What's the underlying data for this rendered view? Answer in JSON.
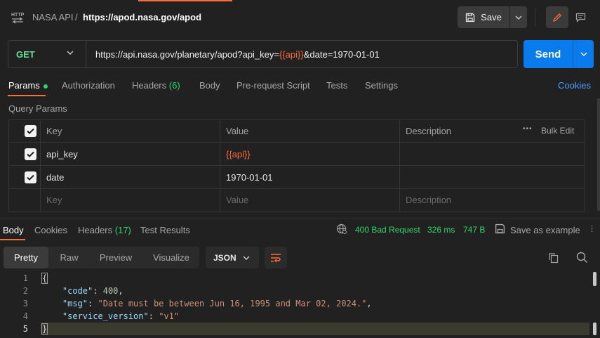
{
  "header": {
    "breadcrumb_parent": "NASA API",
    "breadcrumb_sep": "/",
    "title": "https://apod.nasa.gov/apod",
    "save_label": "Save"
  },
  "request": {
    "method": "GET",
    "url_prefix": "https://api.nasa.gov/planetary/apod?api_key=",
    "url_var": "{{api}}",
    "url_suffix": "&date=1970-01-01",
    "send_label": "Send"
  },
  "tabs": [
    {
      "label": "Params"
    },
    {
      "label": "Authorization"
    },
    {
      "label": "Headers",
      "count": "(6)"
    },
    {
      "label": "Body"
    },
    {
      "label": "Pre-request Script"
    },
    {
      "label": "Tests"
    },
    {
      "label": "Settings"
    }
  ],
  "cookies_label": "Cookies",
  "query_params": {
    "title": "Query Params",
    "columns": [
      "Key",
      "Value",
      "Description"
    ],
    "bulk_edit": "Bulk Edit",
    "more": "•••",
    "rows": [
      {
        "key": "api_key",
        "value": "{{api}}",
        "description": ""
      },
      {
        "key": "date",
        "value": "1970-01-01",
        "description": ""
      }
    ],
    "placeholder": {
      "key": "Key",
      "value": "Value",
      "description": "Description"
    }
  },
  "response": {
    "tabs": [
      {
        "label": "Body"
      },
      {
        "label": "Cookies"
      },
      {
        "label": "Headers",
        "count": "(17)"
      },
      {
        "label": "Test Results"
      }
    ],
    "status": "400 Bad Request",
    "time": "326 ms",
    "size": "747 B",
    "save_example": "Save as example",
    "views": [
      "Pretty",
      "Raw",
      "Preview",
      "Visualize"
    ],
    "format": "JSON",
    "code": {
      "line_numbers": [
        "1",
        "2",
        "3",
        "4",
        "5"
      ],
      "open_brace": "{",
      "close_brace": "}",
      "code_key": "\"code\"",
      "code_val": "400",
      "msg_key": "\"msg\"",
      "msg_val": "\"Date must be between Jun 16, 1995 and Mar 02, 2024.\"",
      "sv_key": "\"service_version\"",
      "sv_val": "\"v1\""
    }
  },
  "colors": {
    "accent": "#ff6c37",
    "send": "#097bed",
    "success": "#2bd66b",
    "method_get": "#6bdd9a",
    "link": "#4ca0ff"
  }
}
